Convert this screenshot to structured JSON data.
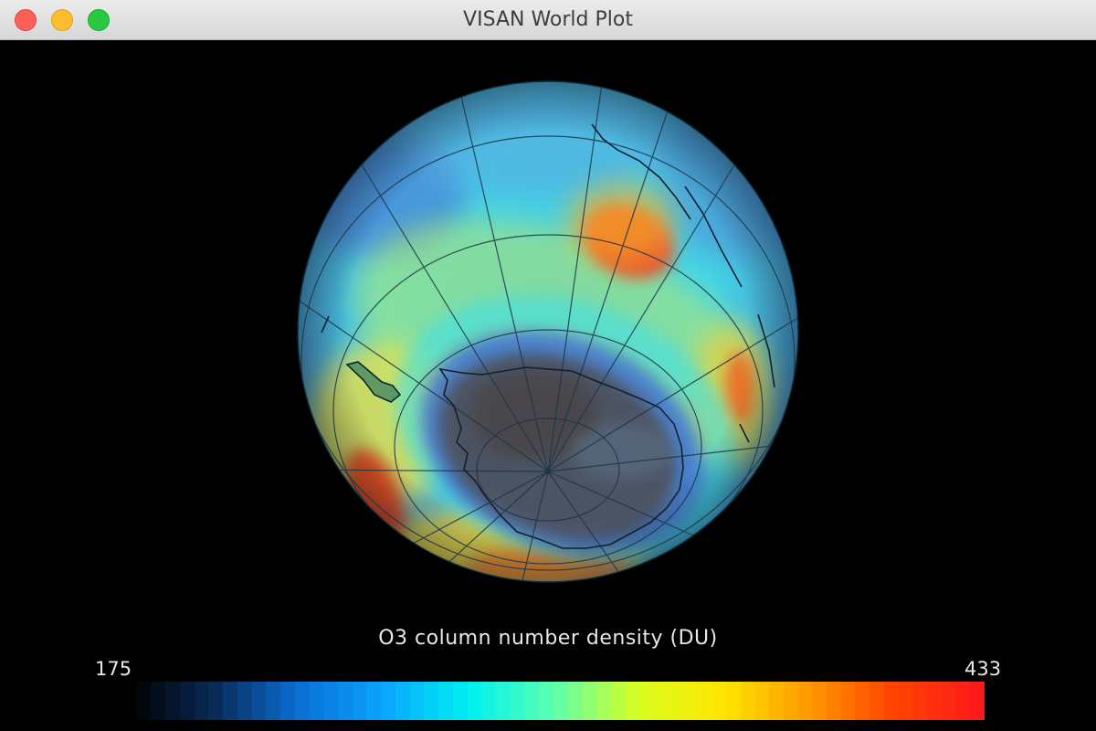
{
  "window": {
    "title": "VISAN World Plot"
  },
  "plot": {
    "variable_label": "O3 column number density (DU)",
    "colorbar": {
      "min_label": "175",
      "max_label": "433",
      "min_value": 175,
      "max_value": 433,
      "colors": [
        "#000000",
        "#0a2a55",
        "#0a6fd6",
        "#0aa5ff",
        "#00f0f0",
        "#5cffb0",
        "#d8ff20",
        "#ffe600",
        "#ff9a00",
        "#ff4400",
        "#ff1a1a"
      ]
    },
    "projection": "orthographic",
    "view": "south-pole"
  }
}
